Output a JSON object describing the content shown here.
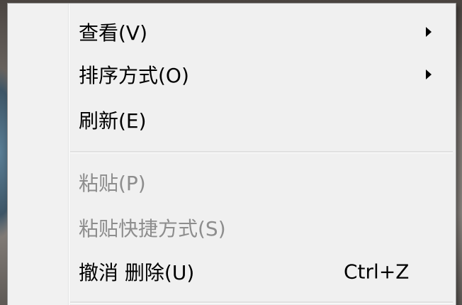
{
  "context_menu": {
    "items": [
      {
        "label": "查看(V)",
        "submenu": true
      },
      {
        "label": "排序方式(O)",
        "submenu": true
      },
      {
        "label": "刷新(E)"
      },
      {
        "label": "粘贴(P)",
        "disabled": true
      },
      {
        "label": "粘贴快捷方式(S)",
        "disabled": true
      },
      {
        "label": "撤消 删除(U)",
        "shortcut": "Ctrl+Z"
      }
    ]
  },
  "icons": {
    "submenu": "chevron-right-icon"
  },
  "colors": {
    "menu_background": "#f0f0f0",
    "disabled_text": "#8d8d8d",
    "text": "#000000"
  }
}
